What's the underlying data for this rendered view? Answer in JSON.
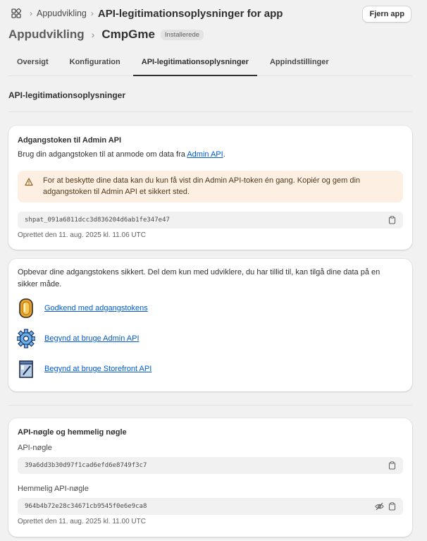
{
  "breadcrumb": {
    "parent": "Appudvikling",
    "current": "API-legitimationsoplysninger for app"
  },
  "header": {
    "remove_app": "Fjern app",
    "parent_title": "Appudvikling",
    "app_name": "CmpGme",
    "status_badge": "Installerede"
  },
  "tabs": [
    {
      "label": "Oversigt"
    },
    {
      "label": "Konfiguration"
    },
    {
      "label": "API-legitimationsoplysninger",
      "active": true
    },
    {
      "label": "Appindstillinger"
    }
  ],
  "section_heading": "API-legitimationsoplysninger",
  "admin_token_card": {
    "title": "Adgangstoken til Admin API",
    "desc_prefix": "Brug din adgangstoken til at anmode om data fra ",
    "desc_link": "Admin API",
    "desc_suffix": ".",
    "warning_line1": "For at beskytte dine data kan du kun få vist din Admin API-token én gang. Kopiér og gem din",
    "warning_line2": "adgangstoken til Admin API et sikkert sted.",
    "token": "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",
    "created": "Oprettet den 11. aug. 2025 kl. 11.06 UTC"
  },
  "security_card": {
    "text_line1": "Opbevar dine adgangstokens sikkert. Del dem kun med udviklere, du har tillid til, kan tilgå dine data på en",
    "text_line2": "sikker måde.",
    "links": [
      {
        "label": "Godkend med adgangstokens",
        "icon": "coin-icon"
      },
      {
        "label": "Begynd at bruge Admin API",
        "icon": "gear-icon"
      },
      {
        "label": "Begynd at bruge Storefront API",
        "icon": "storefront-icon"
      }
    ]
  },
  "api_keys_card": {
    "title": "API-nøgle og hemmelig nøgle",
    "api_key_label": "API-nøgle",
    "api_key": "39a6dd3b30d97f1cad6efd6e8749f3c7",
    "secret_label": "Hemmelig API-nøgle",
    "secret_key": "964b4b72e28c34671cb9545f0e6e9ca8",
    "created": "Oprettet den 11. aug. 2025 kl. 11.00 UTC"
  },
  "colors": {
    "background": "#f1f1f1",
    "link": "#005bd3",
    "warning_bg": "#fdefe1",
    "badge_bg": "#e3e3e3"
  }
}
